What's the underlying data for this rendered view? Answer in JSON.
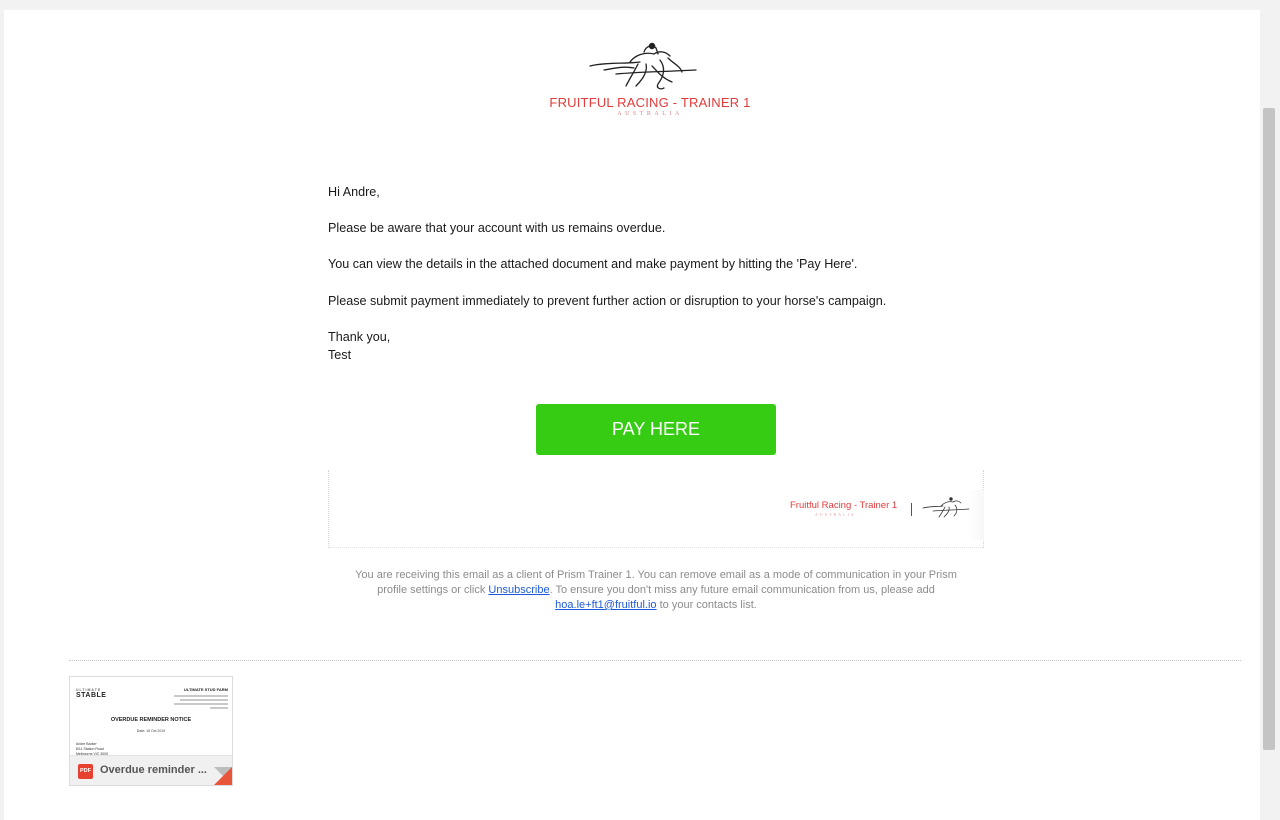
{
  "header": {
    "brand_title": "FRUITFUL RACING - TRAINER 1",
    "brand_subtitle": "AUSTRALIA"
  },
  "email": {
    "greeting": "Hi Andre,",
    "paragraphs": [
      "Please be aware that your account with us remains overdue.",
      "You can view the details in the attached document and make payment by hitting the 'Pay Here'.",
      "Please submit payment immediately to prevent further action or disruption to your horse's campaign."
    ],
    "closing": "Thank you,",
    "signer": "Test",
    "pay_button_label": "PAY HERE"
  },
  "signature": {
    "name": "Fruitful Racing - Trainer 1",
    "subtitle": "AUSTRALIA"
  },
  "footer": {
    "text_before_link": "You are receiving this email as a client of Prism Trainer 1. You can remove email as a mode of communication in your Prism profile settings or click ",
    "unsubscribe_label": "Unsubscribe",
    "text_middle": ". To ensure you don't miss any future email communication from us, please add ",
    "contact_email": "hoa.le+ft1@fruitful.io",
    "text_after": " to your contacts list."
  },
  "attachment": {
    "file_name": "Overdue reminder ...",
    "file_type": "PDF",
    "preview": {
      "brand": "STABLE",
      "brand_small": "ULTIMATE",
      "company": "ULTIMATE STUD FARM",
      "title": "OVERDUE REMINDER NOTICE",
      "date": "Date: 16 Oct 2019",
      "address_lines": [
        "Andre Barker",
        "8/11 Station Road",
        "Melbourne VIC 3000"
      ]
    }
  },
  "colors": {
    "brand_red": "#e23b3b",
    "pay_button_green": "#36cc13",
    "link_blue": "#1f5bd8",
    "pdf_red": "#e8402f"
  },
  "icons": [
    "horse-jockey-logo-icon",
    "pdf-file-icon"
  ]
}
